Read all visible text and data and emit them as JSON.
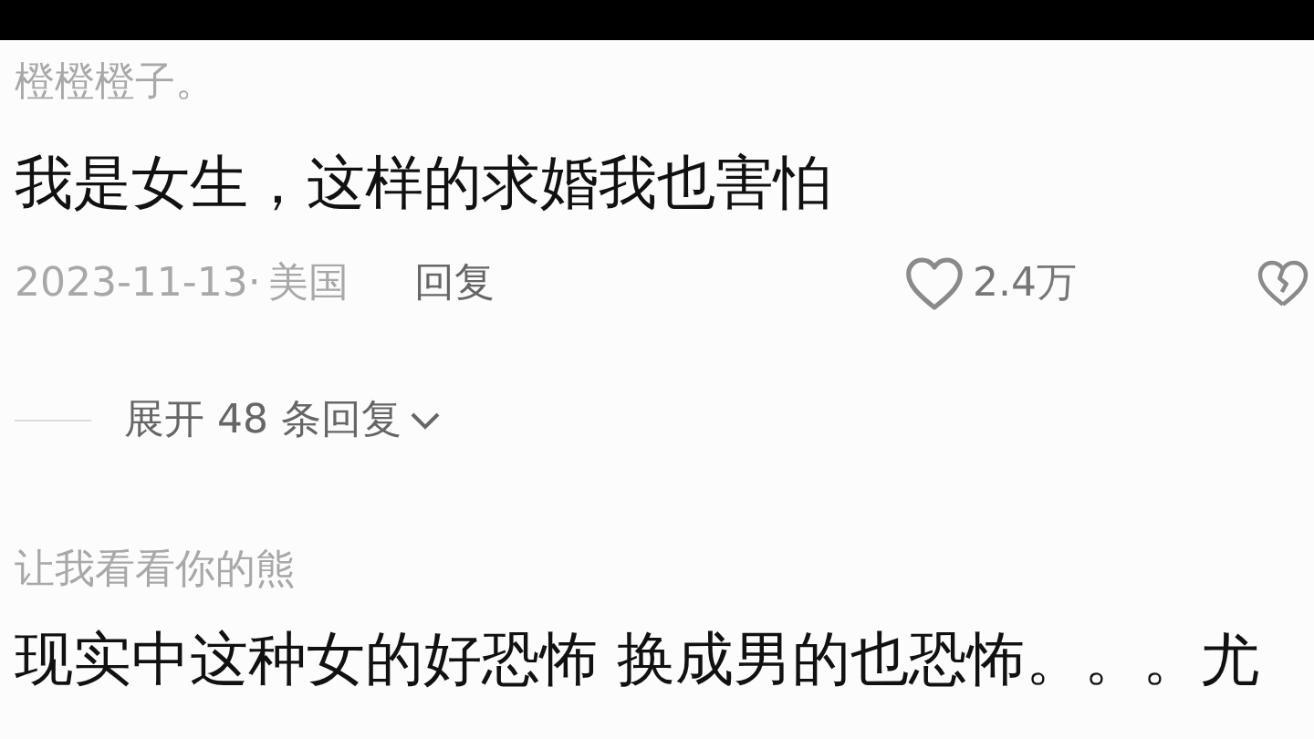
{
  "comments": [
    {
      "username": "橙橙橙子。",
      "text": "我是女生，这样的求婚我也害怕",
      "date": "2023-11-13·",
      "location": "美国",
      "reply_label": "回复",
      "likes": "2.4万",
      "liked": false,
      "disliked": false,
      "expand_replies": "展开 48 条回复"
    },
    {
      "username": "让我看看你的熊",
      "text": "现实中这种女的好恐怖 换成男的也恐怖。。。尤"
    }
  ]
}
